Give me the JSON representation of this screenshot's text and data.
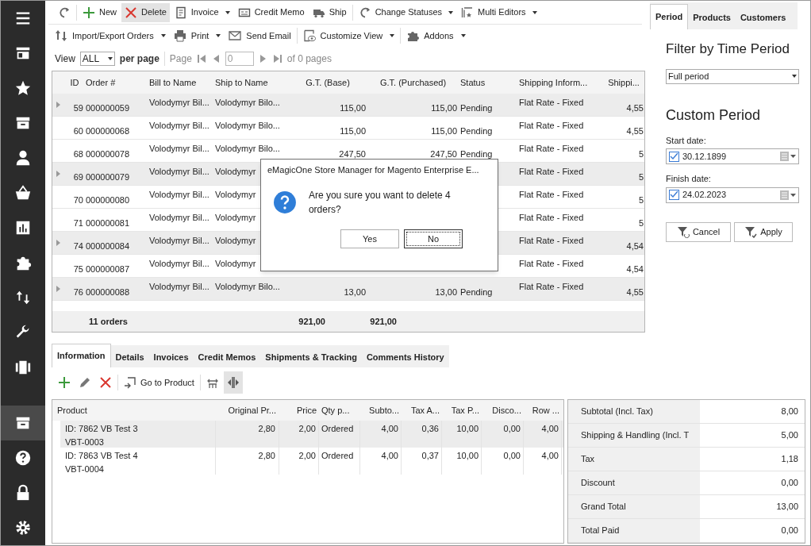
{
  "sidebar": {
    "items": [
      {
        "kind": "menu",
        "selected": false
      },
      {
        "kind": "store",
        "selected": false
      },
      {
        "kind": "star",
        "selected": false
      },
      {
        "kind": "archive",
        "selected": false
      },
      {
        "kind": "user",
        "selected": false
      },
      {
        "kind": "basket",
        "selected": false
      },
      {
        "kind": "chart",
        "selected": false
      },
      {
        "kind": "puzzle",
        "selected": false
      },
      {
        "kind": "arrows",
        "selected": false
      },
      {
        "kind": "wrench",
        "selected": false
      },
      {
        "kind": "film",
        "selected": false
      }
    ],
    "bottom_items": [
      {
        "kind": "archive",
        "selected": true
      },
      {
        "kind": "help",
        "selected": false
      },
      {
        "kind": "lock",
        "selected": false
      },
      {
        "kind": "gear",
        "selected": false
      }
    ]
  },
  "toolbar_1": [
    {
      "kind": "refresh",
      "dropdown": false,
      "highlighted": false
    },
    {
      "kind": "plus",
      "label": "New",
      "dropdown": false,
      "highlighted": false
    },
    {
      "kind": "cross",
      "label": "Delete",
      "dropdown": false,
      "highlighted": true
    },
    {
      "kind": "doc",
      "label": "Invoice",
      "dropdown": true,
      "highlighted": false
    },
    {
      "kind": "card",
      "label": "Credit Memo",
      "dropdown": false,
      "highlighted": false
    },
    {
      "kind": "truck",
      "label": "Ship",
      "dropdown": false,
      "highlighted": false
    },
    {
      "kind": "refresh",
      "label": "Change Statuses",
      "dropdown": true,
      "highlighted": false
    },
    {
      "kind": "stack",
      "label": "Multi Editors",
      "dropdown": true,
      "highlighted": false
    }
  ],
  "toolbar_2": [
    {
      "kind": "arrows",
      "label": "Import/Export Orders",
      "dropdown": true,
      "highlighted": false
    },
    {
      "kind": "printer",
      "label": "Print",
      "dropdown": true,
      "highlighted": false
    },
    {
      "kind": "mail",
      "label": "Send Email",
      "dropdown": false,
      "highlighted": false
    },
    {
      "kind": "eye",
      "label": "Customize View",
      "dropdown": true,
      "highlighted": false
    },
    {
      "kind": "puzzle",
      "label": "Addons",
      "dropdown": true,
      "highlighted": false
    }
  ],
  "pager": {
    "view_label": "View",
    "per_page_value": "ALL",
    "per_page_label": "per page",
    "page_label": "Page",
    "page_value": "0",
    "of_pages": "of 0 pages"
  },
  "orders_table": {
    "columns": [
      "ID",
      "Order #",
      "Bill to Name",
      "Ship to Name",
      "G.T. (Base)",
      "G.T. (Purchased)",
      "Status",
      "Shipping Inform...",
      "Shippi..."
    ],
    "rows": [
      {
        "selected": true,
        "cells": [
          "59",
          "000000059",
          "Volodymyr Bil...",
          "Volodymyr Bilo...",
          "115,00",
          "115,00",
          "Pending",
          "Flat Rate - Fixed",
          "4,55"
        ]
      },
      {
        "selected": false,
        "cells": [
          "60",
          "000000068",
          "Volodymyr Bil...",
          "Volodymyr Bilo...",
          "115,00",
          "115,00",
          "Pending",
          "Flat Rate - Fixed",
          "4,55"
        ]
      },
      {
        "selected": false,
        "cells": [
          "68",
          "000000078",
          "Volodymyr Bil...",
          "Volodymyr Bilo...",
          "247,50",
          "247,50",
          "Pending",
          "Flat Rate - Fixed",
          "5"
        ]
      },
      {
        "selected": true,
        "cells": [
          "69",
          "000000079",
          "Volodymyr Bil...",
          "Volodymyr",
          null,
          null,
          null,
          "Flat Rate - Fixed",
          "5"
        ]
      },
      {
        "selected": false,
        "cells": [
          "70",
          "000000080",
          "Volodymyr Bil...",
          "Volodymyr",
          null,
          null,
          null,
          "Flat Rate - Fixed",
          "5"
        ]
      },
      {
        "selected": false,
        "cells": [
          "71",
          "000000081",
          "Volodymyr Bil...",
          "Volodymyr",
          null,
          null,
          null,
          "Flat Rate - Fixed",
          "5"
        ]
      },
      {
        "selected": true,
        "cells": [
          "74",
          "000000084",
          "Volodymyr Bil...",
          "Volodymyr",
          null,
          null,
          null,
          "Flat Rate - Fixed",
          "4,54"
        ]
      },
      {
        "selected": false,
        "cells": [
          "75",
          "000000087",
          "Volodymyr Bil...",
          "Volodymyr",
          null,
          null,
          null,
          "Flat Rate - Fixed",
          "4,54"
        ]
      },
      {
        "selected": true,
        "cells": [
          "76",
          "000000088",
          "Volodymyr Bil...",
          "Volodymyr Bilo...",
          "13,00",
          "13,00",
          "Pending",
          "Flat Rate - Fixed",
          "4,55"
        ]
      }
    ],
    "footer": {
      "count": "11 orders",
      "base_total": "921,00",
      "purchased_total": "921,00"
    }
  },
  "dialog": {
    "title": "eMagicOne Store Manager for Magento Enterprise E...",
    "message": "Are you sure you want to delete 4 orders?",
    "buttons": [
      {
        "label": "Yes",
        "focused": false
      },
      {
        "label": "No",
        "focused": true
      }
    ]
  },
  "right_panel": {
    "tabs": [
      {
        "label": "Period",
        "selected": true
      },
      {
        "label": "Products",
        "selected": false
      },
      {
        "label": "Customers",
        "selected": false
      }
    ],
    "heading": "Filter by Time Period",
    "period_value": "Full period",
    "custom_heading": "Custom Period",
    "dates": [
      {
        "label": "Start date:",
        "value": "30.12.1899",
        "checked": true
      },
      {
        "label": "Finish date:",
        "value": "24.02.2023",
        "checked": true
      }
    ],
    "buttons": [
      {
        "kind": "cancel",
        "label": "Cancel"
      },
      {
        "kind": "apply",
        "label": "Apply"
      }
    ]
  },
  "detail_tabs": [
    {
      "label": "Information",
      "selected": true
    },
    {
      "label": "Details",
      "selected": false
    },
    {
      "label": "Invoices",
      "selected": false
    },
    {
      "label": "Credit Memos",
      "selected": false
    },
    {
      "label": "Shipments & Tracking",
      "selected": false
    },
    {
      "label": "Comments History",
      "selected": false
    }
  ],
  "detail_toolbar": [
    {
      "kind": "plus",
      "highlighted": false
    },
    {
      "kind": "pencil",
      "highlighted": false
    },
    {
      "kind": "cross",
      "highlighted": false
    },
    {
      "kind": "goto",
      "label": "Go to Product",
      "highlighted": false
    },
    {
      "kind": "fit",
      "highlighted": false
    },
    {
      "kind": "split",
      "highlighted": true
    }
  ],
  "products_table": {
    "columns": [
      "Product",
      "Original Pr...",
      "Price",
      "Qty p...",
      "Subto...",
      "Tax A...",
      "Tax P...",
      "Disco...",
      "Row ..."
    ],
    "rows": [
      {
        "selected": true,
        "cells": [
          "ID: 7862 VB Test 3\nVBT-0003",
          "2,80",
          "2,00",
          "Ordered",
          "4,00",
          "0,36",
          "10,00",
          "0,00",
          "4,00"
        ]
      },
      {
        "selected": false,
        "cells": [
          "ID: 7863 VB Test 4\nVBT-0004",
          "2,80",
          "2,00",
          "Ordered",
          "4,00",
          "0,37",
          "10,00",
          "0,00",
          "4,00"
        ]
      }
    ]
  },
  "totals": [
    {
      "label": "Subtotal  (Incl. Tax)",
      "value": "8,00"
    },
    {
      "label": "Shipping & Handling (Incl. T",
      "value": "5,00"
    },
    {
      "label": "Tax",
      "value": "1,18"
    },
    {
      "label": "Discount",
      "value": "0,00"
    },
    {
      "label": "Grand Total",
      "value": "13,00"
    },
    {
      "label": "Total Paid",
      "value": "0,00"
    }
  ]
}
